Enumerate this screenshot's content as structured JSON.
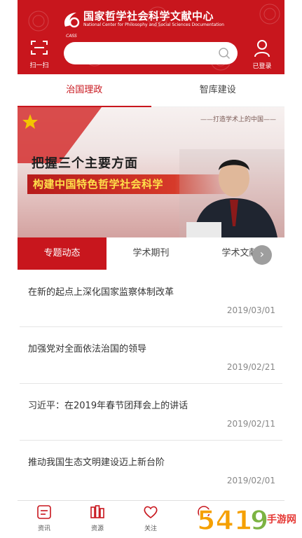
{
  "header": {
    "logo_cn": "国家哲学社会科学文献中心",
    "logo_en": "National Center for Philosophy and Social Sciences Documentation",
    "logo_abbr": "CASS",
    "scan_label": "扫一扫",
    "search_placeholder": "",
    "user_label": "已登录",
    "brand_color": "#c8161d"
  },
  "main_tabs": [
    {
      "label": "治国理政",
      "active": true
    },
    {
      "label": "智库建设",
      "active": false
    }
  ],
  "banner": {
    "slogan": "——打造学术上的中国——",
    "line1": "把握三个主要方面",
    "line2": "构建中国特色哲学社会科学"
  },
  "sub_tabs": [
    {
      "label": "专题动态",
      "active": true
    },
    {
      "label": "学术期刊",
      "active": false
    },
    {
      "label": "学术文献",
      "active": false
    }
  ],
  "news": [
    {
      "title": "在新的起点上深化国家监察体制改革",
      "date": "2019/03/01"
    },
    {
      "title": "加强党对全面依法治国的领导",
      "date": "2019/02/21"
    },
    {
      "title": "习近平：在2019年春节团拜会上的讲话",
      "date": "2019/02/11"
    },
    {
      "title": "推动我国生态文明建设迈上新台阶",
      "date": "2019/02/01"
    }
  ],
  "bottom_nav": [
    {
      "label": "资讯",
      "icon": "news-icon"
    },
    {
      "label": "资源",
      "icon": "resource-icon"
    },
    {
      "label": "关注",
      "icon": "heart-icon"
    },
    {
      "label": "",
      "icon": "more-icon"
    }
  ],
  "watermark": "5419手游网"
}
